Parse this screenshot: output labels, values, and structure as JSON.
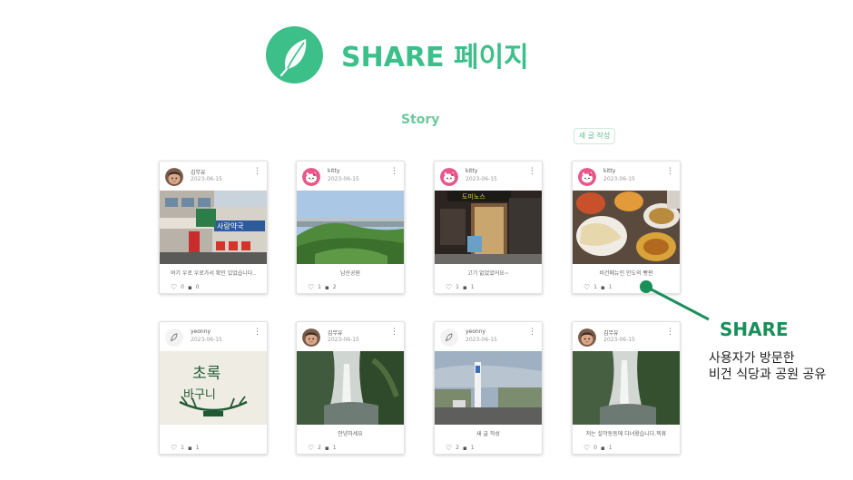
{
  "header": {
    "title": "SHARE 페이지",
    "logo_icon": "leaf-icon"
  },
  "section": {
    "story_label": "Story",
    "new_post_button": "새 글 작성"
  },
  "colors": {
    "brand": "#3dbf8a",
    "annotation": "#1a8f5a"
  },
  "posts": [
    {
      "user": "김무유",
      "date": "2023-06-15",
      "caption": "여기 우로 우로가서 확인 있었습니다..",
      "likes": "0",
      "comments": "0",
      "avatar_icon": "person-avatar"
    },
    {
      "user": "kitty",
      "date": "2023-06-15",
      "caption": "남산공원",
      "likes": "1",
      "comments": "2",
      "avatar_icon": "hello-kitty-avatar"
    },
    {
      "user": "kitty",
      "date": "2023-06-15",
      "caption": "고기 없었었어요~",
      "likes": "1",
      "comments": "1",
      "avatar_icon": "hello-kitty-avatar"
    },
    {
      "user": "kitty",
      "date": "2023-06-15",
      "caption": "비건메뉴인 인도의 빵판",
      "likes": "1",
      "comments": "1",
      "avatar_icon": "hello-kitty-avatar"
    },
    {
      "user": "yeonny",
      "date": "2023-06-15",
      "caption": "",
      "likes": "1",
      "comments": "1",
      "avatar_icon": "logo-avatar"
    },
    {
      "user": "김무유",
      "date": "2023-06-15",
      "caption": "안녕하세요",
      "likes": "2",
      "comments": "1",
      "avatar_icon": "person-avatar"
    },
    {
      "user": "yeonny",
      "date": "2023-06-15",
      "caption": "새 글 작성",
      "likes": "2",
      "comments": "1",
      "avatar_icon": "logo-avatar"
    },
    {
      "user": "김무유",
      "date": "2023-06-15",
      "caption": "저는 설악동동에 다녀왔습니다.찍휴",
      "likes": "0",
      "comments": "1",
      "avatar_icon": "person-avatar"
    }
  ],
  "annotation": {
    "title": "SHARE",
    "line1": "사용자가 방문한",
    "line2": "비건 식당과 공원 공유"
  }
}
